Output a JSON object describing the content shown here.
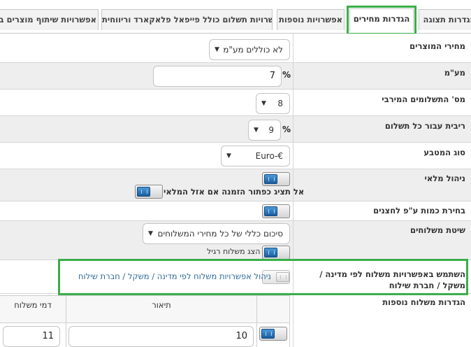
{
  "tabs": [
    {
      "label": "אפשרויות שיתוף מוצרים בפ",
      "active": false
    },
    {
      "label": "אפשרויות תשלום כולל פייפאל פלאקארד וריווחית",
      "active": false
    },
    {
      "label": "אפשרויות נוספות",
      "active": false
    },
    {
      "label": "הגדרות מחירים",
      "active": true
    },
    {
      "label": "הגדרות תצוגה",
      "active": false
    }
  ],
  "rows": {
    "prices": {
      "label": "מחירי המוצרים",
      "value": "לא כוללים מע\"מ"
    },
    "vat": {
      "label": "מע\"מ",
      "value": "7",
      "unit": "%"
    },
    "max_payments": {
      "label": "מס' התשלומים המירבי",
      "value": "8"
    },
    "interest": {
      "label": "ריבית עבור כל תשלום",
      "value": "9",
      "unit": "%"
    },
    "currency": {
      "label": "סוג המטבע",
      "value": "Euro-€"
    },
    "inventory": {
      "label": "ניהול מלאי",
      "toggle_on": true,
      "sub_label": "אל תציג כפתור הזמנה אם אזל המלאי",
      "sub_toggle_on": true
    },
    "quantity": {
      "label": "בחירת כמות ע\"פ לחצנים",
      "toggle_on": true
    },
    "shipping_method": {
      "label": "שיטת משלוחים",
      "value": "סיכום כללי של כל מחירי המשלוחים",
      "sub_label": "הצג משלוח רגיל",
      "sub_toggle_on": true
    },
    "shipping_options": {
      "label": "השתמש באפשרויות משלוח לפי מדינה / משקל / חברת שילוח",
      "toggle_on": false,
      "link_text": "ניהול אפשרויות משלוח לפי מדינה / משקל / חברת שילוח"
    },
    "extra_shipping": {
      "label": "הגדרות משלוח נוספות"
    }
  },
  "shipping_table": {
    "columns": [
      "דמי משלוח",
      "תיאור",
      ""
    ],
    "rows": [
      {
        "fee": "11",
        "description": "10",
        "enabled": true
      }
    ]
  },
  "colors": {
    "highlight": "#3aae49",
    "link": "#2d6a96",
    "toggle_blue": "#1a5e9f"
  }
}
